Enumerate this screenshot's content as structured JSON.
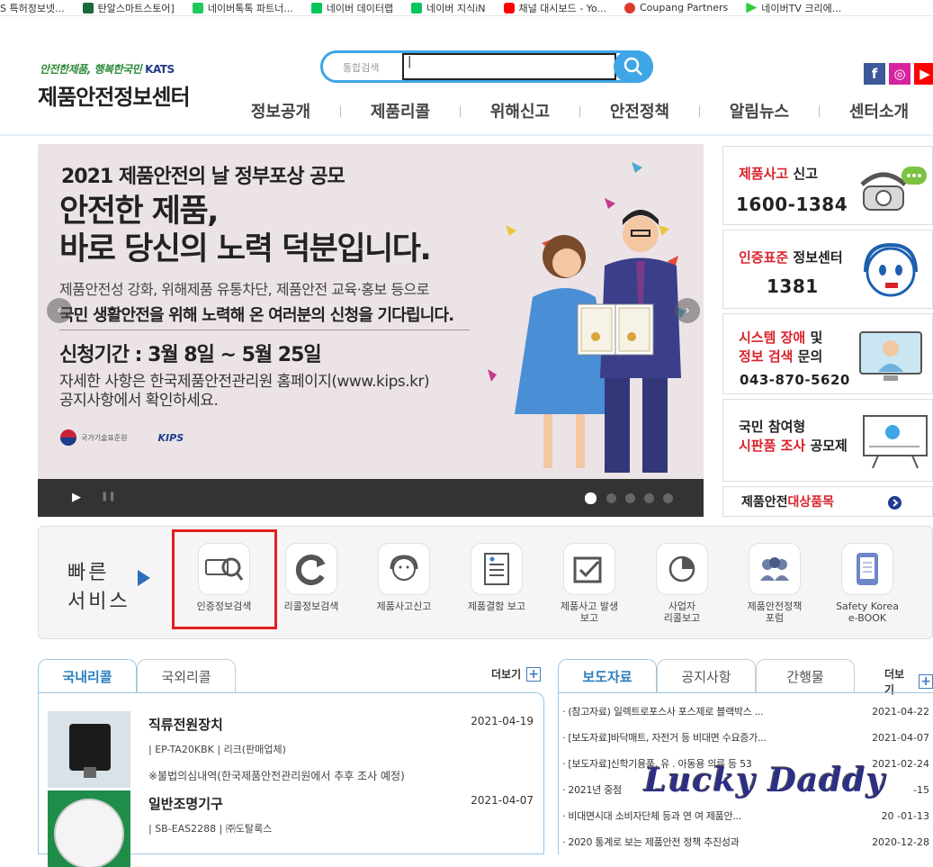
{
  "bookmarks": [
    {
      "label": "S 특허정보넷...",
      "color": "#ffffff"
    },
    {
      "label": "탄알스마트스토어]",
      "color": "#1a6a3a"
    },
    {
      "label": "네이버톡톡 파트너...",
      "color": "#21c85a"
    },
    {
      "label": "네이버 데이터랩",
      "color": "#03c75a"
    },
    {
      "label": "네이버 지식iN",
      "color": "#03c75a"
    },
    {
      "label": "채널 대시보드 - Yo...",
      "color": "#ff0000"
    },
    {
      "label": "Coupang Partners",
      "color": "#e03a2f"
    },
    {
      "label": "네이버TV 크리에...",
      "color": "#2ecc40"
    }
  ],
  "header": {
    "tagline": "안전한제품, 행복한국민",
    "tagline_brand": "KATS",
    "title": "제품안전정보센터",
    "search_placeholder": "통합검색",
    "search_value": "|",
    "sns": [
      "f",
      "◎",
      "▶"
    ],
    "nav": [
      "정보공개",
      "제품리콜",
      "위해신고",
      "안전정책",
      "알림뉴스",
      "센터소개"
    ]
  },
  "banner": {
    "line1": "2021 제품안전의 날 정부포상 공모",
    "line2a": "안전한 제품,",
    "line2b": "바로 당신의 노력 덕분입니다.",
    "line3": "제품안전성 강화, 위해제품 유통차단, 제품안전 교육·홍보 등으로",
    "line4": "국민 생활안전을 위해 노력해 온 여러분의 신청을 기다립니다.",
    "period": "신청기간 : 3월 8일 ~ 5월 25일",
    "detail1": "자세한 사항은 한국제품안전관리원 홈페이지(www.kips.kr)",
    "detail2": "공지사항에서 확인하세요.",
    "logo1": "국가기술표준원",
    "logo2": "KIPS",
    "prev": "‹",
    "next": "›",
    "play": "▶",
    "pause": "❚❚",
    "slide_count": 5,
    "active_slide": 1
  },
  "side": {
    "accident_red": "제품사고",
    "accident_rest": " 신고",
    "accident_num": "1600-1384",
    "cert_red": "인증표준",
    "cert_rest": " 정보센터",
    "cert_num": "1381",
    "sys_red1": "시스템 장애",
    "sys_rest1": " 및",
    "sys_red2": "정보 검색",
    "sys_rest2": " 문의",
    "sys_num": "043-870-5620",
    "pub_line1": "국민 참여형",
    "pub_red": "시판품 조사",
    "pub_rest": " 공모제",
    "target_black": "제품안전 ",
    "target_red": "대상품목"
  },
  "quick": {
    "title_line1": "빠른",
    "title_line2": "서비스",
    "items": [
      {
        "label": "인증정보검색",
        "icon": "cert-search-icon"
      },
      {
        "label": "리콜정보검색",
        "icon": "recall-search-icon"
      },
      {
        "label": "제품사고신고",
        "icon": "accident-report-icon"
      },
      {
        "label": "제품결함 보고",
        "icon": "defect-report-icon"
      },
      {
        "label": "제품사고 발생\n보고",
        "icon": "accident-occur-icon"
      },
      {
        "label": "사업자\n리콜보고",
        "icon": "business-recall-icon"
      },
      {
        "label": "제품안전정책\n포럼",
        "icon": "forum-icon"
      },
      {
        "label": "Safety Korea\ne-BOOK",
        "icon": "ebook-icon"
      }
    ]
  },
  "recall": {
    "tabs": [
      "국내리콜",
      "국외리콜"
    ],
    "more": "더보기",
    "items": [
      {
        "title": "직류전원장치",
        "date": "2021-04-19",
        "sub": "| EP-TA20KBK | 리크(판매업체)",
        "note": "※불법의심내역(한국제품안전관리원에서 추후 조사 예정)"
      },
      {
        "title": "일반조명기구",
        "date": "2021-04-07",
        "sub": "| SB-EAS2288 | ㈜도탈룩스",
        "note": ""
      }
    ]
  },
  "press": {
    "tabs": [
      "보도자료",
      "공지사항",
      "간행물"
    ],
    "more": "더보기",
    "items": [
      {
        "title": "· (참고자료) 일렉트로포스사 포스제로 블랙박스 ...",
        "date": "2021-04-22"
      },
      {
        "title": "· [보도자료]바닥매트, 자전거 등 비대면 수요증가...",
        "date": "2021-04-07"
      },
      {
        "title": "· [보도자료]신학기용품, 유 . 아동용 의류 등 53",
        "date": "2021-02-24"
      },
      {
        "title": "· 2021년 중점",
        "date": "-15"
      },
      {
        "title": "· 비대면시대 소비자단체 등과 연         여 제품안...",
        "date": "20  -01-13"
      },
      {
        "title": "· 2020 통계로 보는 제품안전 정책 추진성과",
        "date": "2020-12-28"
      }
    ]
  },
  "watermark": "Lucky Daddy"
}
